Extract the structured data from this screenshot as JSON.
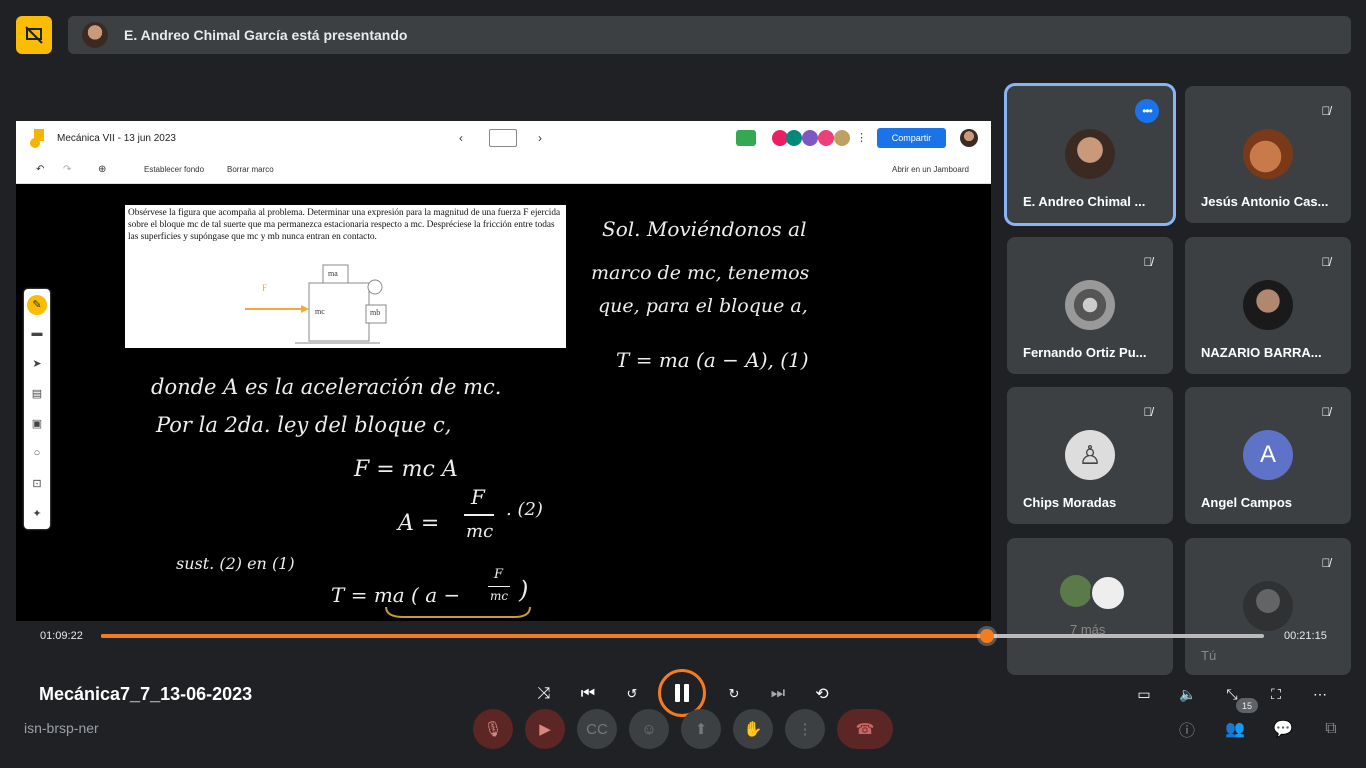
{
  "banner": {
    "presenting_text": "E. Andreo Chimal García está presentando"
  },
  "jamboard": {
    "title": "Mecánica VII - 13 jun 2023",
    "share_label": "Compartir",
    "toolbar": {
      "set_background": "Establecer fondo",
      "clear_frame": "Borrar marco",
      "open_in_jamboard": "Abrir en un Jamboard"
    },
    "problem_text": "Obsérvese la figura que acompaña al problema. Determinar una expresión para la magnitud de una fuerza F ejercida sobre el bloque mc de tal suerte que ma permanezca estacionaria respecto a mc. Despréciese la fricción entre todas las superficies y supóngase que mc y mb nunca entran en contacto.",
    "diagram": {
      "force_label": "F",
      "block_a": "ma",
      "block_b": "mb",
      "block_c": "mc"
    },
    "handwriting": {
      "line1": "Sol. Moviéndonos al",
      "line2": "marco de mc, tenemos",
      "line3": "que, para el bloque a,",
      "eq1": "T = ma (a − A),  (1)",
      "line4": "donde A es la aceleración de mc.",
      "line5": "Por la 2da. ley del bloque c,",
      "eq2": "F = mc A",
      "eq3_lhs": "A =",
      "eq3_num": "F",
      "eq3_den": "mc",
      "eq3_tag": ". (2)",
      "line6": "sust. (2) en (1)",
      "eq4_lhs": "T = ma ( a −",
      "eq4_num": "F",
      "eq4_den": "mc",
      "eq4_close": ")"
    }
  },
  "player": {
    "elapsed": "01:09:22",
    "remaining": "00:21:15",
    "progress": 0.762,
    "title": "Mecánica7_7_13-06-2023"
  },
  "meet": {
    "code": "isn-brsp-ner",
    "people_count": "15"
  },
  "participants": [
    {
      "name": "E. Andreo Chimal ...",
      "selected": true,
      "avatar": "photo"
    },
    {
      "name": "Jesús Antonio Cas...",
      "avatar": "photo"
    },
    {
      "name": "Fernando Ortiz Pu...",
      "avatar": "photo"
    },
    {
      "name": "NAZARIO BARRA...",
      "avatar": "photo"
    },
    {
      "name": "Chips Moradas",
      "avatar": "photo"
    },
    {
      "name": "Angel Campos",
      "avatar": "letter",
      "letter": "A",
      "color": "#5e73c8"
    },
    {
      "name": "7 más",
      "avatar": "group"
    },
    {
      "name": "Tú",
      "avatar": "photo"
    }
  ],
  "colors": {
    "accent": "#f47c20",
    "selected": "#8ab4f8",
    "share": "#1a73e8",
    "jamboard": "#fbbc04"
  }
}
